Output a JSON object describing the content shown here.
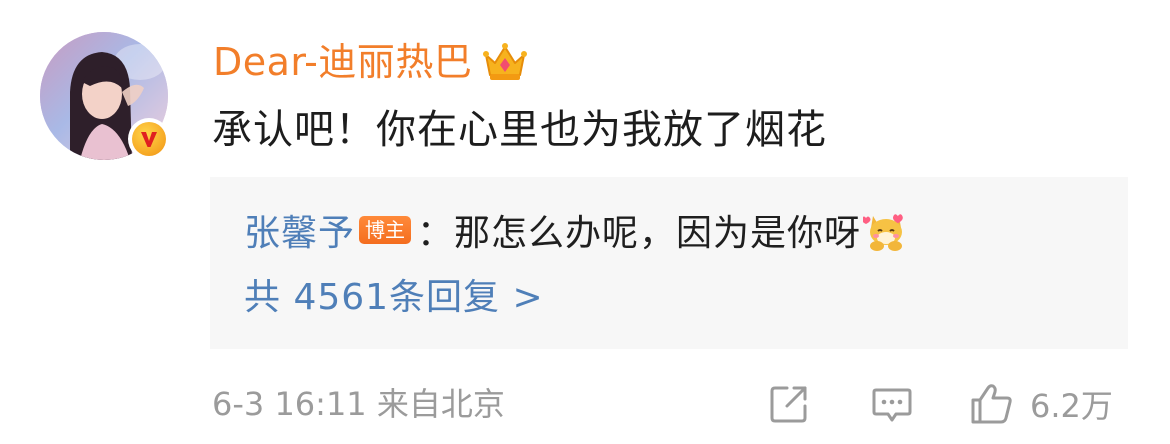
{
  "comment": {
    "author": {
      "name": "Dear-迪丽热巴",
      "badge_icon": "crown-icon",
      "verified_icon": "vip-v-icon",
      "name_color": "#f27e2a"
    },
    "text": "承认吧！你在心里也为我放了烟花",
    "reply_preview": {
      "author": "张馨予",
      "host_badge": "博主",
      "separator": "：",
      "text": "那怎么办呢，因为是你呀",
      "emoji_icon": "shy-dog-emoji-icon",
      "more_replies": "共 4561条回复 >",
      "link_color": "#4f7fb8"
    },
    "time": "6-3 16:11",
    "location": "来自北京",
    "actions": {
      "share_icon": "share-icon",
      "comment_icon": "comment-icon",
      "like_icon": "thumbs-up-icon",
      "like_count": "6.2万"
    }
  }
}
